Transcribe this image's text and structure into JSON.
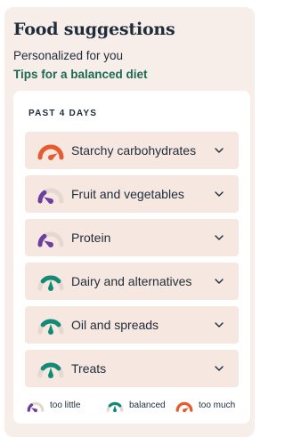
{
  "header": {
    "title": "Food suggestions",
    "subtitle": "Personalized for you",
    "tips_link": "Tips for a balanced diet"
  },
  "panel": {
    "section_heading": "PAST 4 DAYS",
    "items": [
      {
        "label": "Starchy carbohydrates",
        "status": "too much",
        "gauge_icon": "gauge-too-much-icon"
      },
      {
        "label": "Fruit and vegetables",
        "status": "too little",
        "gauge_icon": "gauge-too-little-icon"
      },
      {
        "label": "Protein",
        "status": "too little",
        "gauge_icon": "gauge-too-little-icon"
      },
      {
        "label": "Dairy and alternatives",
        "status": "balanced",
        "gauge_icon": "gauge-balanced-icon"
      },
      {
        "label": "Oil and spreads",
        "status": "balanced",
        "gauge_icon": "gauge-balanced-icon"
      },
      {
        "label": "Treats",
        "status": "balanced",
        "gauge_icon": "gauge-balanced-icon"
      }
    ],
    "legend": {
      "too_little": "too little",
      "balanced": "balanced",
      "too_much": "too much"
    }
  },
  "colors": {
    "too_little": "#6b3fa0",
    "balanced": "#138a76",
    "too_much": "#e65a2e",
    "track": "#e4d9d1",
    "card_bg": "#f7ede9",
    "item_bg": "#f6e7e1",
    "link": "#1c6a55"
  },
  "icons": {
    "chevron": "chevron-down-icon"
  }
}
